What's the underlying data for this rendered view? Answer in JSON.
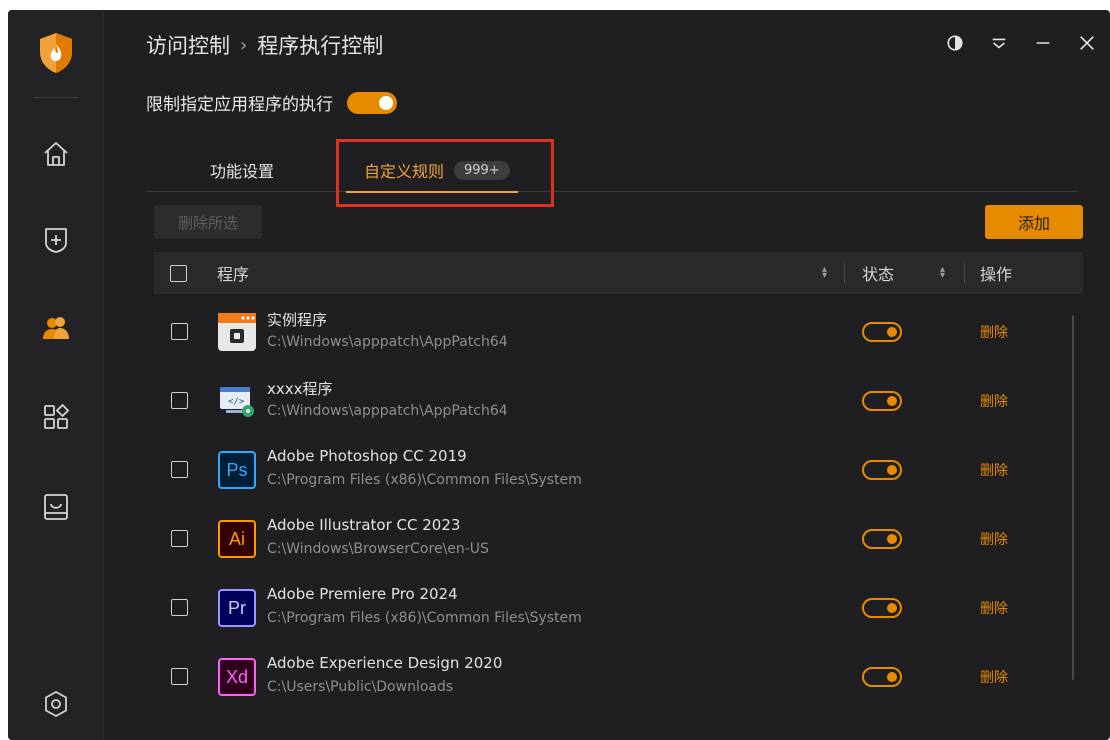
{
  "breadcrumb": {
    "parent": "访问控制",
    "separator": "›",
    "current": "程序执行控制"
  },
  "window_controls": [
    "theme-icon",
    "menu-icon",
    "minimize-icon",
    "close-icon"
  ],
  "restrict": {
    "label": "限制指定应用程序的执行",
    "enabled": true
  },
  "tabs": [
    {
      "label": "功能设置",
      "active": false
    },
    {
      "label": "自定义规则",
      "active": true,
      "badge": "999+"
    }
  ],
  "toolbar": {
    "delete_selected_label": "删除所选",
    "add_label": "添加"
  },
  "table": {
    "columns": {
      "program": "程序",
      "status": "状态",
      "action": "操作"
    },
    "rows": [
      {
        "icon": "sample-program-icon",
        "name": "实例程序",
        "path": "C:\\Windows\\apppatch\\AppPatch64",
        "status_on": true,
        "action": "删除"
      },
      {
        "icon": "code-program-icon",
        "name": "xxxx程序",
        "path": "C:\\Windows\\apppatch\\AppPatch64",
        "status_on": true,
        "action": "删除"
      },
      {
        "icon": "photoshop-icon",
        "icon_text": "Ps",
        "name": "Adobe Photoshop CC 2019",
        "path": "C:\\Program Files (x86)\\Common Files\\System",
        "status_on": true,
        "action": "删除"
      },
      {
        "icon": "illustrator-icon",
        "icon_text": "Ai",
        "name": "Adobe Illustrator CC 2023",
        "path": "C:\\Windows\\BrowserCore\\en-US",
        "status_on": true,
        "action": "删除"
      },
      {
        "icon": "premiere-icon",
        "icon_text": "Pr",
        "name": "Adobe Premiere Pro 2024",
        "path": "C:\\Program Files (x86)\\Common Files\\System",
        "status_on": true,
        "action": "删除"
      },
      {
        "icon": "xd-icon",
        "icon_text": "Xd",
        "name": "Adobe Experience Design 2020",
        "path": "C:\\Users\\Public\\Downloads",
        "status_on": true,
        "action": "删除"
      }
    ]
  },
  "colors": {
    "accent": "#e68a00",
    "background": "#1f1f21",
    "highlight_box": "#e0301f"
  }
}
